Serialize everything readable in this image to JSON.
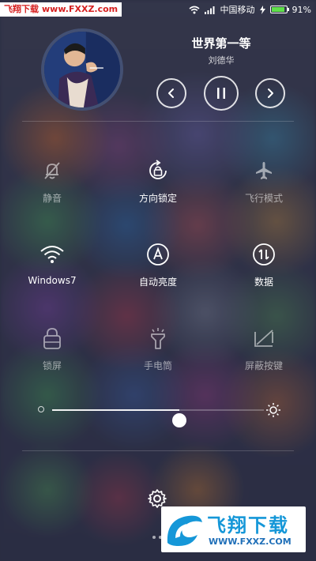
{
  "status_bar": {
    "watermark_text_a": "飞翔下载",
    "watermark_text_b": "www.FXXZ.com",
    "carrier": "中国移动",
    "battery_percent": "91%",
    "battery_level": 0.91,
    "icons": [
      "wifi-icon",
      "signal-icon",
      "charging-icon",
      "battery-icon"
    ]
  },
  "music": {
    "title": "世界第一等",
    "artist": "刘德华",
    "controls": [
      "previous-icon",
      "pause-icon",
      "next-icon"
    ]
  },
  "toggles": [
    {
      "label": "静音",
      "icon": "bell-off-icon",
      "active": false
    },
    {
      "label": "方向锁定",
      "icon": "rotation-lock-icon",
      "active": true
    },
    {
      "label": "飞行模式",
      "icon": "airplane-icon",
      "active": false
    },
    {
      "label": "Windows7",
      "icon": "wifi-icon",
      "active": true
    },
    {
      "label": "自动亮度",
      "icon": "auto-brightness-icon",
      "active": true
    },
    {
      "label": "数据",
      "icon": "mobile-data-icon",
      "active": true
    },
    {
      "label": "锁屏",
      "icon": "lock-icon",
      "active": false
    },
    {
      "label": "手电筒",
      "icon": "flashlight-icon",
      "active": false
    },
    {
      "label": "屏蔽按键",
      "icon": "block-keys-icon",
      "active": false
    }
  ],
  "brightness": {
    "level": 0.6
  },
  "bottom_watermark": {
    "text_cn": "飞翔下载",
    "url": "WWW.FXXZ.COM"
  },
  "colors": {
    "battery_fill": "#5fe04a",
    "watermark_red": "#d62020",
    "watermark_blue": "#1597d8"
  }
}
